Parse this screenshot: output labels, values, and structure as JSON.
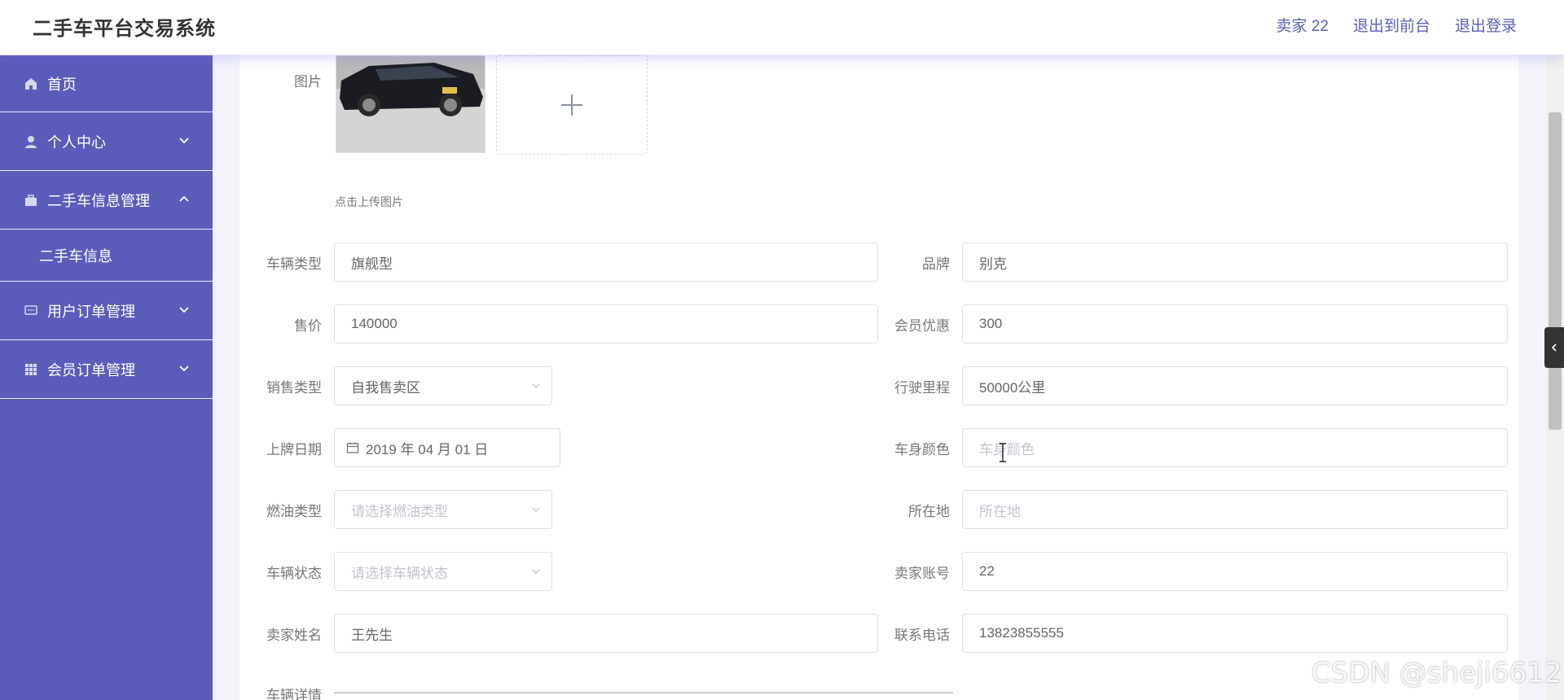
{
  "header": {
    "app_title": "二手车平台交易系统",
    "user_label": "卖家 22",
    "back_front_label": "退出到前台",
    "logout_label": "退出登录"
  },
  "sidebar": {
    "items": [
      {
        "label": "首页",
        "icon": "home-icon"
      },
      {
        "label": "个人中心",
        "icon": "user-icon",
        "expanded": false
      },
      {
        "label": "二手车信息管理",
        "icon": "briefcase-icon",
        "expanded": true,
        "children": [
          {
            "label": "二手车信息"
          }
        ]
      },
      {
        "label": "用户订单管理",
        "icon": "chat-icon",
        "expanded": false
      },
      {
        "label": "会员订单管理",
        "icon": "grid-icon",
        "expanded": false
      }
    ]
  },
  "form": {
    "image_label": "图片",
    "upload_tip": "点击上传图片",
    "vehicle_type": {
      "label": "车辆类型",
      "value": "旗舰型"
    },
    "brand": {
      "label": "品牌",
      "value": "别克"
    },
    "price": {
      "label": "售价",
      "value": "140000"
    },
    "member_discount": {
      "label": "会员优惠",
      "value": "300"
    },
    "sale_type": {
      "label": "销售类型",
      "value": "自我售卖区"
    },
    "mileage": {
      "label": "行驶里程",
      "value": "50000公里"
    },
    "plate_date": {
      "label": "上牌日期",
      "value": "2019 年 04 月 01 日"
    },
    "body_color": {
      "label": "车身颜色",
      "placeholder": "车身颜色"
    },
    "fuel_type": {
      "label": "燃油类型",
      "placeholder": "请选择燃油类型"
    },
    "location": {
      "label": "所在地",
      "placeholder": "所在地"
    },
    "vehicle_status": {
      "label": "车辆状态",
      "placeholder": "请选择车辆状态"
    },
    "seller_account": {
      "label": "卖家账号",
      "value": "22"
    },
    "seller_name": {
      "label": "卖家姓名",
      "value": "王先生"
    },
    "phone": {
      "label": "联系电话",
      "value": "13823855555"
    },
    "detail": {
      "label": "车辆详情"
    }
  },
  "watermark": "CSDN @sheji6612",
  "colors": {
    "sidebar": "#5b5cb9",
    "accent": "#5b5fb8"
  }
}
